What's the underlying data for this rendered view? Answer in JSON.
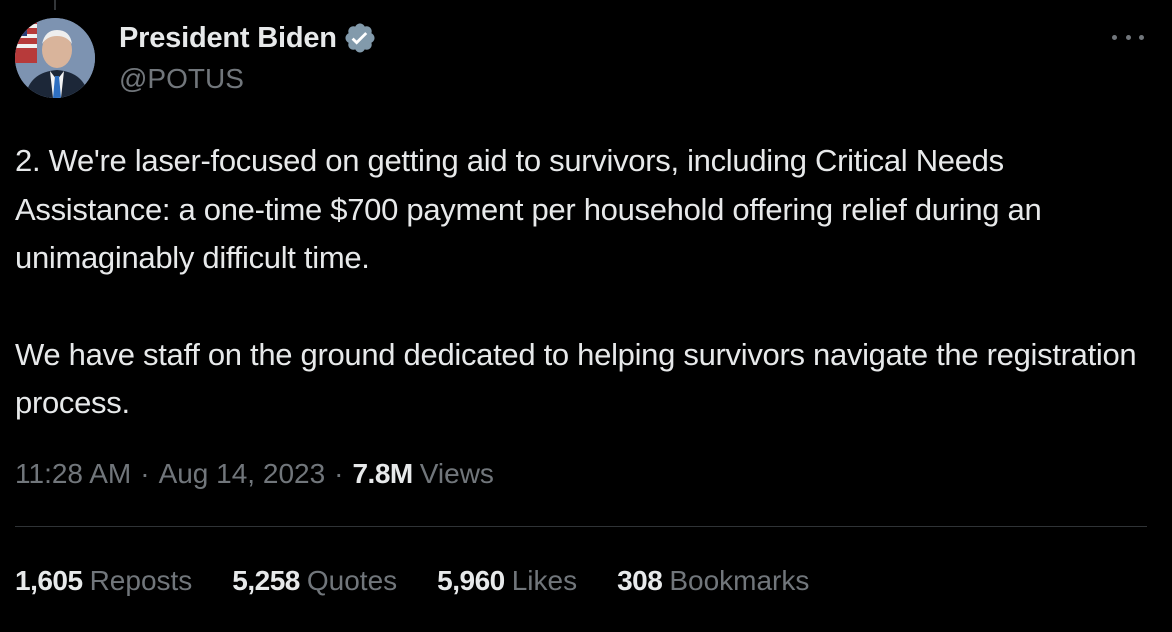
{
  "author": {
    "display_name": "President Biden",
    "handle": "@POTUS",
    "verified_icon": "verified-badge-icon",
    "more_icon": "more-options-icon"
  },
  "tweet": {
    "paragraph_1": "2. We're laser-focused on getting aid to survivors, including Critical Needs Assistance: a one-time $700 payment per household offering relief during an unimaginably difficult time.",
    "paragraph_2": "We have staff on the ground dedicated to helping survivors navigate the registration process."
  },
  "meta": {
    "time": "11:28 AM",
    "separator": "·",
    "date": "Aug 14, 2023",
    "views_count": "7.8M",
    "views_label": "Views"
  },
  "stats": {
    "reposts_count": "1,605",
    "reposts_label": "Reposts",
    "quotes_count": "5,258",
    "quotes_label": "Quotes",
    "likes_count": "5,960",
    "likes_label": "Likes",
    "bookmarks_count": "308",
    "bookmarks_label": "Bookmarks"
  },
  "colors": {
    "background": "#000000",
    "primary_text": "#e7e9ea",
    "secondary_text": "#71767b",
    "verified_blue": "#829aab",
    "divider": "#2f3336"
  }
}
